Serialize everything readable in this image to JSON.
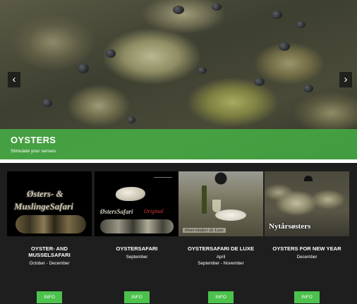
{
  "hero": {
    "title": "OYSTERS",
    "subtitle": "Stimulate your senses",
    "prev_icon": "chevron-left-icon",
    "next_icon": "chevron-right-icon",
    "prev_glyph": "‹",
    "next_glyph": "›"
  },
  "products": [
    {
      "title_line1": "OYSTER- AND",
      "title_line2": "MUSSELSAFARI",
      "date": "October - December",
      "button": "INFO",
      "image_text_1": "Østers- &",
      "image_text_2": "MuslingeSafari"
    },
    {
      "title_line1": "OYSTERSAFARI",
      "date": "September",
      "button": "INFO",
      "image_text_1": "ØstersSafari",
      "image_text_2": "Original"
    },
    {
      "title_line1": "OYSTERSAFARI DE LUXE",
      "date_line1": "April",
      "date_line2": "September - November",
      "button": "INFO",
      "image_text_1": "ØstersSafari de Luxe"
    },
    {
      "title_line1": "OYSTERS FOR NEW YEAR",
      "date": "December",
      "button": "INFO",
      "image_text_1": "Nytårsøsters"
    }
  ],
  "colors": {
    "accent_green": "#4cc24c",
    "caption_green": "#46b446",
    "panel_bg": "#1e1e1e"
  }
}
